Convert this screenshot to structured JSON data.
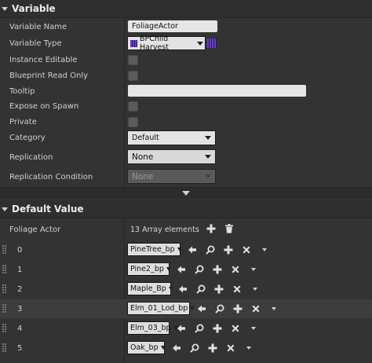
{
  "variable_section": {
    "title": "Variable",
    "fields": {
      "variable_name": {
        "label": "Variable Name",
        "value": "FoliageActor"
      },
      "variable_type": {
        "label": "Variable Type",
        "value": "BPChild Harvest"
      },
      "instance_editable": {
        "label": "Instance Editable"
      },
      "blueprint_read_only": {
        "label": "Blueprint Read Only"
      },
      "tooltip": {
        "label": "Tooltip",
        "value": ""
      },
      "expose_on_spawn": {
        "label": "Expose on Spawn"
      },
      "private": {
        "label": "Private"
      },
      "category": {
        "label": "Category",
        "value": "Default"
      },
      "replication": {
        "label": "Replication",
        "value": "None"
      },
      "replication_condition": {
        "label": "Replication Condition",
        "value": "None"
      }
    }
  },
  "default_value_section": {
    "title": "Default Value",
    "array_label": "Foliage Actor",
    "array_count": "13 Array elements",
    "elements": [
      {
        "index": "0",
        "value": "PineTree_bp"
      },
      {
        "index": "1",
        "value": "Pine2_bp"
      },
      {
        "index": "2",
        "value": "Maple_Bp"
      },
      {
        "index": "3",
        "value": "Elm_01_Lod_bp"
      },
      {
        "index": "4",
        "value": "Elm_03_bp"
      },
      {
        "index": "5",
        "value": "Oak_bp"
      }
    ]
  },
  "colors": {
    "panel_bg": "#333333",
    "type_icon_purple": "#6a3cc8"
  }
}
